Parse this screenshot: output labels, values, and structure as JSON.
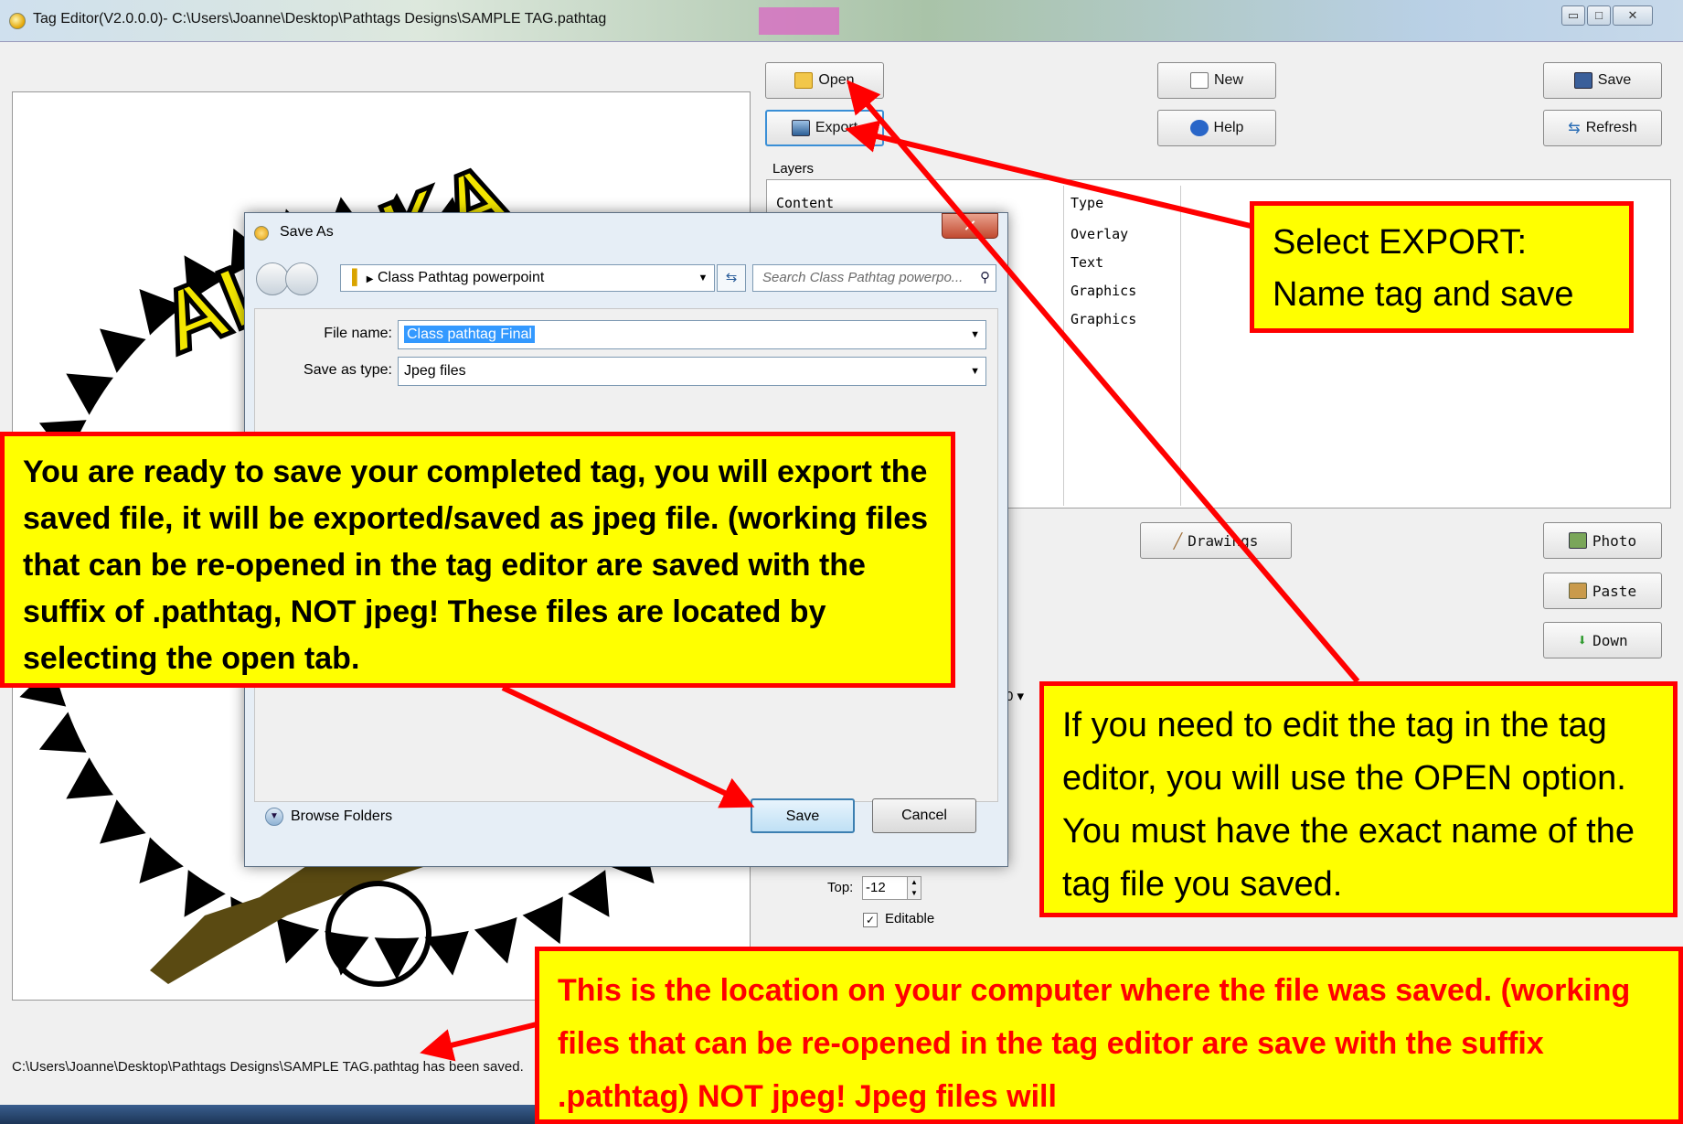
{
  "window": {
    "title": "Tag Editor(V2.0.0.0)- C:\\Users\\Joanne\\Desktop\\Pathtags Designs\\SAMPLE TAG.pathtag",
    "minimize_glyph": "▭",
    "maximize_glyph": "□",
    "close_glyph": "✕"
  },
  "toolbar": {
    "open_label": "Open",
    "export_label": "Export",
    "new_label": "New",
    "help_label": "Help",
    "save_label": "Save",
    "refresh_label": "Refresh"
  },
  "layers": {
    "label": "Layers",
    "columns": [
      "Content",
      "Type"
    ],
    "types": [
      "Overlay",
      "Text",
      "Graphics",
      "Graphics"
    ]
  },
  "tools": {
    "drawings_label": "Drawings",
    "photo_label": "Photo",
    "paste_label": "Paste",
    "down_label": "Down"
  },
  "properties": {
    "top_label": "Top:",
    "top_value": "-12",
    "editable_label": "Editable",
    "editable_checked": true,
    "size_fragment": "0"
  },
  "canvas": {
    "text_fragment": "ALASKA"
  },
  "status": {
    "message": "C:\\Users\\Joanne\\Desktop\\Pathtags Designs\\SAMPLE TAG.pathtag has been saved."
  },
  "save_dialog": {
    "title": "Save As",
    "address": "Class Pathtag powerpoint",
    "search_placeholder": "Search Class Pathtag powerpo...",
    "file_name_label": "File name:",
    "file_name_value": "Class pathtag Final",
    "save_as_type_label": "Save as type:",
    "save_as_type_value": "Jpeg files",
    "browse_folders_label": "Browse Folders",
    "save_button": "Save",
    "cancel_button": "Cancel"
  },
  "callouts": {
    "export_note": "Select EXPORT: Name tag and save",
    "save_note": "You are ready to save your completed tag,  you will export the saved file, it will be exported/saved as jpeg file. (working files that can be re-opened in the tag editor are saved with the suffix of .pathtag, NOT  jpeg! These files are located by selecting the open tab.",
    "open_note": "If  you need to edit the tag in the tag editor, you will use the OPEN option.  You must have the exact name of the tag file you saved.",
    "location_note": "This is the location on your computer where the file was saved. (working files that can be re-opened in the tag editor are save with the suffix .pathtag)  NOT  jpeg!  Jpeg files will"
  },
  "colors": {
    "callout_fill": "#ffff00",
    "callout_border": "#ff0000",
    "arrow": "#ff0000",
    "selection": "#3399ff"
  }
}
